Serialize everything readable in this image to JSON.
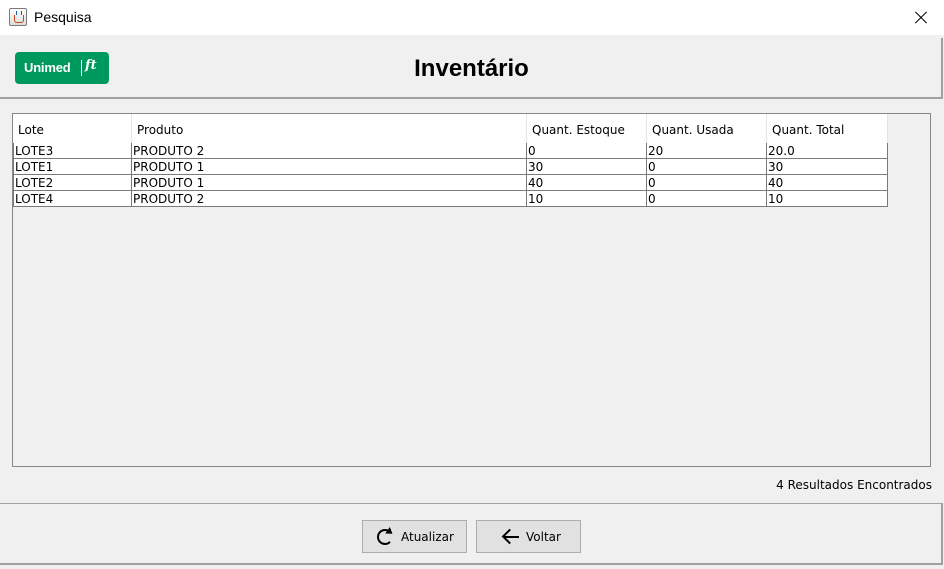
{
  "window": {
    "title": "Pesquisa"
  },
  "header": {
    "logo_text": "Unimed",
    "logo_mark": "ft",
    "title": "Inventário"
  },
  "table": {
    "columns": [
      "Lote",
      "Produto",
      "Quant. Estoque",
      "Quant. Usada",
      "Quant. Total"
    ],
    "rows": [
      [
        "LOTE3",
        "PRODUTO 2",
        "0",
        "20",
        "20.0"
      ],
      [
        "LOTE1",
        "PRODUTO 1",
        "30",
        "0",
        "30"
      ],
      [
        "LOTE2",
        "PRODUTO 1",
        "40",
        "0",
        "40"
      ],
      [
        "LOTE4",
        "PRODUTO 2",
        "10",
        "0",
        "10"
      ]
    ]
  },
  "status": {
    "results_text": "4 Resultados Encontrados"
  },
  "buttons": {
    "refresh_label": "Atualizar",
    "back_label": "Voltar"
  },
  "colors": {
    "brand_green": "#00995d",
    "window_bg": "#f0f0f0"
  },
  "icons": {
    "app": "java-cup-icon",
    "close": "close-icon",
    "refresh": "refresh-icon",
    "back": "arrow-left-icon"
  }
}
